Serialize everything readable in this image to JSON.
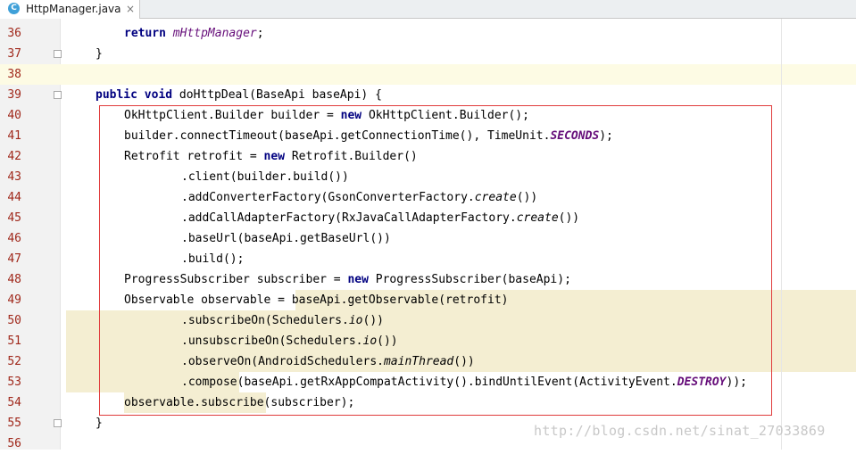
{
  "tab": {
    "icon_letter": "C",
    "title": "HttpManager.java",
    "close": "×"
  },
  "line_numbers": [
    "36",
    "37",
    "38",
    "39",
    "40",
    "41",
    "42",
    "43",
    "44",
    "45",
    "46",
    "47",
    "48",
    "49",
    "50",
    "51",
    "52",
    "53",
    "54",
    "55",
    "56"
  ],
  "code": {
    "l36_kw": "return",
    "l36_field": "mHttpManager",
    "l36_tail": ";",
    "l37": "}",
    "l39_kw": "public void",
    "l39_rest": " doHttpDeal(BaseApi baseApi) {",
    "l40_a": "OkHttpClient.Builder builder = ",
    "l40_kw": "new",
    "l40_b": " OkHttpClient.Builder();",
    "l41_a": "builder.connectTimeout(baseApi.getConnectionTime(), TimeUnit.",
    "l41_field": "SECONDS",
    "l41_b": ");",
    "l42_a": "Retrofit retrofit = ",
    "l42_kw": "new",
    "l42_b": " Retrofit.Builder()",
    "l43": ".client(builder.build())",
    "l44_a": ".addConverterFactory(GsonConverterFactory.",
    "l44_m": "create",
    "l44_b": "())",
    "l45_a": ".addCallAdapterFactory(RxJavaCallAdapterFactory.",
    "l45_m": "create",
    "l45_b": "())",
    "l46": ".baseUrl(baseApi.getBaseUrl())",
    "l47": ".build();",
    "l48_a": "ProgressSubscriber subscriber = ",
    "l48_kw": "new",
    "l48_b": " ProgressSubscriber(baseApi);",
    "l49_a": "Observable observable = ",
    "l49_b": "baseApi.getObservable(retrofit)",
    "l50_a": ".subscribeOn(Schedulers.",
    "l50_m": "io",
    "l50_b": "())",
    "l51_a": ".unsubscribeOn(Schedulers.",
    "l51_m": "io",
    "l51_b": "())",
    "l52_a": ".observeOn(AndroidSchedulers.",
    "l52_m": "mainThread",
    "l52_b": "())",
    "l53_a": ".compose",
    "l53_b": "(baseApi.getRxAppCompatActivity().bindUntilEvent(ActivityEvent.",
    "l53_field": "DESTROY",
    "l53_c": "));",
    "l54_a": "observable.subscribe",
    "l54_b": "(subscriber);",
    "l55": "}"
  },
  "watermark": "http://blog.csdn.net/sinat_27033869",
  "colors": {
    "keyword": "#000080",
    "field": "#660e7a",
    "line_number": "#a0281b",
    "highlight": "#f4eed2",
    "selection_box": "#e03b3b"
  }
}
